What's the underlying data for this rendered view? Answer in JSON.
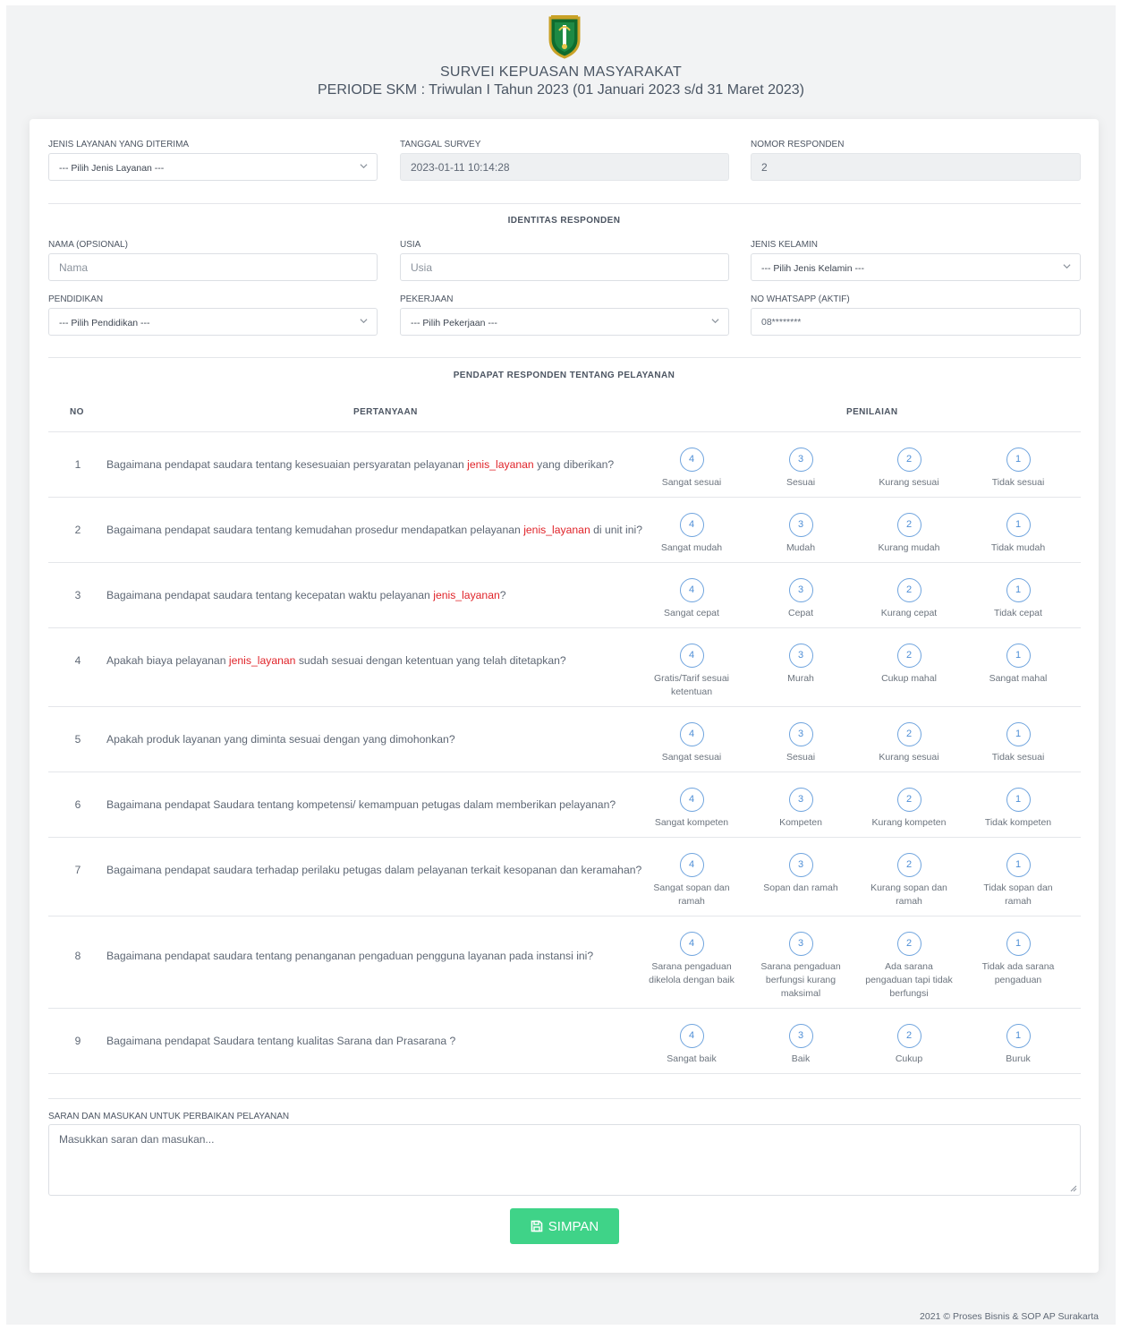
{
  "header": {
    "title": "SURVEI KEPUASAN MASYARAKAT",
    "period": "PERIODE SKM : Triwulan I Tahun 2023 (01 Januari 2023 s/d 31 Maret 2023)"
  },
  "top_fields": {
    "service": {
      "label": "JENIS LAYANAN YANG DITERIMA",
      "value": "--- Pilih Jenis Layanan ---"
    },
    "date": {
      "label": "TANGGAL SURVEY",
      "value": "2023-01-11 10:14:28"
    },
    "respondent_no": {
      "label": "NOMOR RESPONDEN",
      "value": "2"
    }
  },
  "identity": {
    "section_title": "IDENTITAS RESPONDEN",
    "name": {
      "label": "NAMA (OPSIONAL)",
      "placeholder": "Nama"
    },
    "age": {
      "label": "USIA",
      "placeholder": "Usia"
    },
    "gender": {
      "label": "JENIS KELAMIN",
      "value": "--- Pilih Jenis Kelamin ---"
    },
    "education": {
      "label": "PENDIDIKAN",
      "value": "--- Pilih Pendidikan ---"
    },
    "job": {
      "label": "PEKERJAAN",
      "value": "--- Pilih Pekerjaan ---"
    },
    "whatsapp": {
      "label": "NO WHATSAPP (AKTIF)",
      "placeholder": "08********"
    }
  },
  "opinion": {
    "section_title": "PENDAPAT RESPONDEN TENTANG PELAYANAN",
    "col_no": "NO",
    "col_question": "PERTANYAAN",
    "col_rating": "PENILAIAN",
    "questions": [
      {
        "no": "1",
        "pre": "Bagaimana pendapat saudara tentang kesesuaian persyaratan pelayanan ",
        "hl": "jenis_layanan",
        "post": " yang diberikan?",
        "options": [
          {
            "value": "4",
            "label": "Sangat sesuai"
          },
          {
            "value": "3",
            "label": "Sesuai"
          },
          {
            "value": "2",
            "label": "Kurang sesuai"
          },
          {
            "value": "1",
            "label": "Tidak sesuai"
          }
        ]
      },
      {
        "no": "2",
        "pre": "Bagaimana pendapat saudara tentang kemudahan prosedur mendapatkan pelayanan ",
        "hl": "jenis_layanan",
        "post": " di unit ini?",
        "options": [
          {
            "value": "4",
            "label": "Sangat mudah"
          },
          {
            "value": "3",
            "label": "Mudah"
          },
          {
            "value": "2",
            "label": "Kurang mudah"
          },
          {
            "value": "1",
            "label": "Tidak mudah"
          }
        ]
      },
      {
        "no": "3",
        "pre": "Bagaimana pendapat saudara tentang kecepatan waktu pelayanan ",
        "hl": "jenis_layanan",
        "post": "?",
        "options": [
          {
            "value": "4",
            "label": "Sangat cepat"
          },
          {
            "value": "3",
            "label": "Cepat"
          },
          {
            "value": "2",
            "label": "Kurang cepat"
          },
          {
            "value": "1",
            "label": "Tidak cepat"
          }
        ]
      },
      {
        "no": "4",
        "pre": "Apakah biaya pelayanan ",
        "hl": "jenis_layanan",
        "post": " sudah sesuai dengan ketentuan yang telah ditetapkan?",
        "options": [
          {
            "value": "4",
            "label": "Gratis/Tarif sesuai ketentuan"
          },
          {
            "value": "3",
            "label": "Murah"
          },
          {
            "value": "2",
            "label": "Cukup mahal"
          },
          {
            "value": "1",
            "label": "Sangat mahal"
          }
        ]
      },
      {
        "no": "5",
        "pre": "Apakah produk layanan yang diminta sesuai dengan yang dimohonkan?",
        "hl": "",
        "post": "",
        "options": [
          {
            "value": "4",
            "label": "Sangat sesuai"
          },
          {
            "value": "3",
            "label": "Sesuai"
          },
          {
            "value": "2",
            "label": "Kurang sesuai"
          },
          {
            "value": "1",
            "label": "Tidak sesuai"
          }
        ]
      },
      {
        "no": "6",
        "pre": "Bagaimana pendapat Saudara tentang kompetensi/ kemampuan petugas dalam memberikan pelayanan?",
        "hl": "",
        "post": "",
        "options": [
          {
            "value": "4",
            "label": "Sangat kompeten"
          },
          {
            "value": "3",
            "label": "Kompeten"
          },
          {
            "value": "2",
            "label": "Kurang kompeten"
          },
          {
            "value": "1",
            "label": "Tidak kompeten"
          }
        ]
      },
      {
        "no": "7",
        "pre": "Bagaimana pendapat saudara terhadap perilaku petugas dalam pelayanan terkait kesopanan dan keramahan?",
        "hl": "",
        "post": "",
        "options": [
          {
            "value": "4",
            "label": "Sangat sopan dan ramah"
          },
          {
            "value": "3",
            "label": "Sopan dan ramah"
          },
          {
            "value": "2",
            "label": "Kurang sopan dan ramah"
          },
          {
            "value": "1",
            "label": "Tidak sopan dan ramah"
          }
        ]
      },
      {
        "no": "8",
        "pre": "Bagaimana pendapat saudara tentang penanganan pengaduan pengguna layanan pada instansi ini?",
        "hl": "",
        "post": "",
        "options": [
          {
            "value": "4",
            "label": "Sarana pengaduan dikelola dengan baik"
          },
          {
            "value": "3",
            "label": "Sarana pengaduan berfungsi kurang maksimal"
          },
          {
            "value": "2",
            "label": "Ada sarana pengaduan tapi tidak berfungsi"
          },
          {
            "value": "1",
            "label": "Tidak ada sarana pengaduan"
          }
        ]
      },
      {
        "no": "9",
        "pre": "Bagaimana pendapat Saudara tentang kualitas Sarana dan Prasarana ?",
        "hl": "",
        "post": "",
        "options": [
          {
            "value": "4",
            "label": "Sangat baik"
          },
          {
            "value": "3",
            "label": "Baik"
          },
          {
            "value": "2",
            "label": "Cukup"
          },
          {
            "value": "1",
            "label": "Buruk"
          }
        ]
      }
    ]
  },
  "suggestion": {
    "label": "SARAN DAN MASUKAN UNTUK PERBAIKAN PELAYANAN",
    "placeholder": "Masukkan saran dan masukan..."
  },
  "submit": {
    "label": "SIMPAN",
    "icon": "save-icon",
    "color": "#3fd388"
  },
  "footer": {
    "text": "2021 © Proses Bisnis & SOP AP Surakarta"
  },
  "colors": {
    "accent": "#4d8ed6",
    "highlight": "#e0242a",
    "success": "#3fd388"
  }
}
